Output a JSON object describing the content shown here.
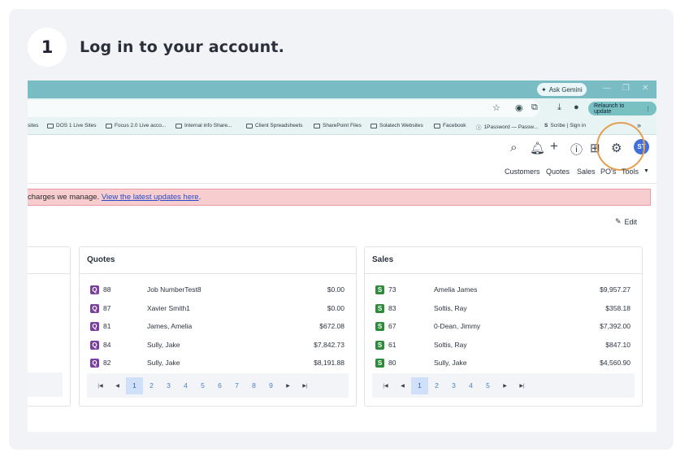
{
  "step": {
    "number": "1",
    "title": "Log in to your account."
  },
  "browser": {
    "gemini_label": "Ask Gemini",
    "relaunch_label": "Relaunch to update",
    "overflow_label": "»",
    "bookmarks": [
      "sites",
      "DOS 1 Live Sites",
      "Focus 2.0 Live acco...",
      "Internal info Share...",
      "Client Spreadsheets",
      "SharePoint Files",
      "Solatech Websites",
      "Facebook",
      "1Password — Passw...",
      "Scribe | Sign in"
    ]
  },
  "app": {
    "avatar_initials": "ST",
    "nav": [
      "Customers",
      "Quotes",
      "Sales",
      "PO's",
      "Tools"
    ],
    "alert": {
      "text": "charges we manage. ",
      "link": "View the latest updates here",
      "tail": "."
    },
    "edit_label": "Edit"
  },
  "quotes": {
    "title": "Quotes",
    "badge": "Q",
    "rows": [
      {
        "id": "88",
        "name": "Job NumberTest8",
        "amount": "$0.00"
      },
      {
        "id": "87",
        "name": "Xavier Smith1",
        "amount": "$0.00"
      },
      {
        "id": "81",
        "name": "James, Amelia",
        "amount": "$672.08"
      },
      {
        "id": "84",
        "name": "Sully, Jake",
        "amount": "$7,842.73"
      },
      {
        "id": "82",
        "name": "Sully, Jake",
        "amount": "$8,191.88"
      }
    ],
    "pages": [
      "1",
      "2",
      "3",
      "4",
      "5",
      "6",
      "7",
      "8",
      "9"
    ]
  },
  "sales": {
    "title": "Sales",
    "badge": "S",
    "rows": [
      {
        "id": "73",
        "name": "Amelia James",
        "amount": "$9,957.27"
      },
      {
        "id": "83",
        "name": "Soltis, Ray",
        "amount": "$358.18"
      },
      {
        "id": "67",
        "name": "0-Dean, Jimmy",
        "amount": "$7,392.00"
      },
      {
        "id": "61",
        "name": "Soltis, Ray",
        "amount": "$847.10"
      },
      {
        "id": "80",
        "name": "Sully, Jake",
        "amount": "$4,560.90"
      }
    ],
    "pages": [
      "1",
      "2",
      "3",
      "4",
      "5"
    ]
  },
  "colors": {
    "highlight": "#e59f54",
    "quote_badge": "#7b3fa0",
    "sale_badge": "#2e8b3a",
    "alert_bg": "#f8cdd0"
  }
}
